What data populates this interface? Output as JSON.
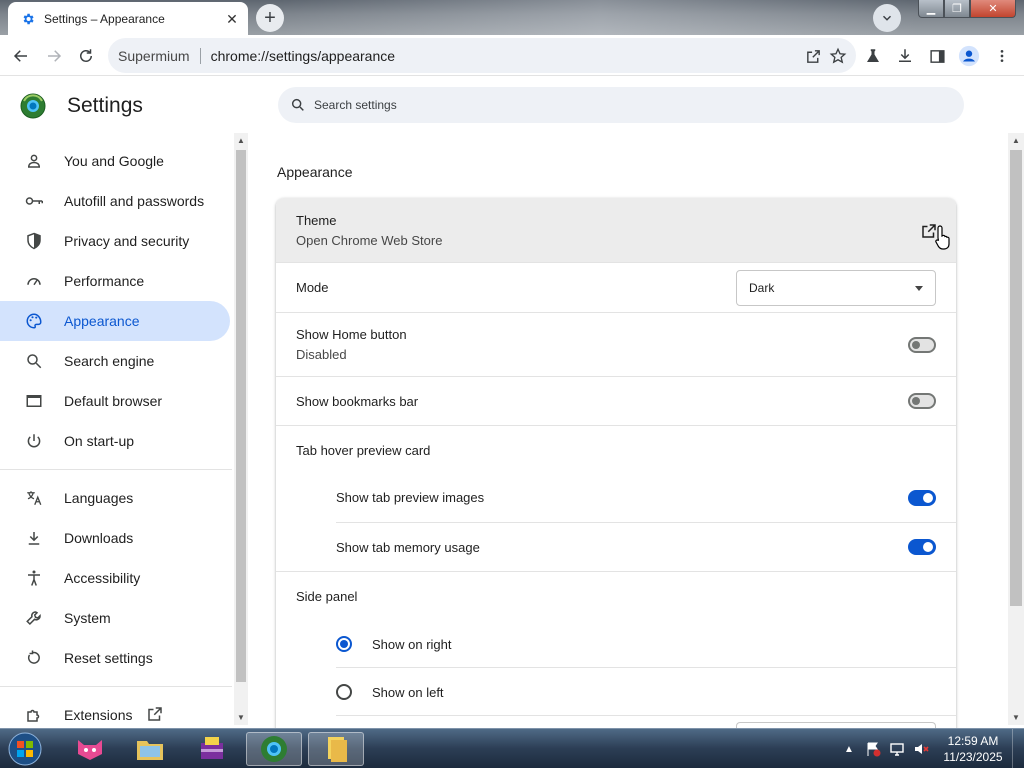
{
  "tab": {
    "title": "Settings – Appearance",
    "close": "✕",
    "new_tab": "+"
  },
  "window": {
    "minimize": "▁",
    "maximize": "❐",
    "close": "✕"
  },
  "omnibox": {
    "chip": "Supermium",
    "url": "chrome://settings/appearance"
  },
  "header": {
    "title": "Settings",
    "search_placeholder": "Search settings"
  },
  "sidebar": {
    "items": [
      {
        "label": "You and Google",
        "icon": "person-icon"
      },
      {
        "label": "Autofill and passwords",
        "icon": "key-icon"
      },
      {
        "label": "Privacy and security",
        "icon": "shield-icon"
      },
      {
        "label": "Performance",
        "icon": "speedometer-icon"
      },
      {
        "label": "Appearance",
        "icon": "palette-icon",
        "active": true
      },
      {
        "label": "Search engine",
        "icon": "search-icon"
      },
      {
        "label": "Default browser",
        "icon": "browser-window-icon"
      },
      {
        "label": "On start-up",
        "icon": "power-icon"
      }
    ],
    "items2": [
      {
        "label": "Languages",
        "icon": "translate-icon"
      },
      {
        "label": "Downloads",
        "icon": "download-icon"
      },
      {
        "label": "Accessibility",
        "icon": "accessibility-icon"
      },
      {
        "label": "System",
        "icon": "wrench-icon"
      },
      {
        "label": "Reset settings",
        "icon": "reset-icon"
      }
    ],
    "extensions": {
      "label": "Extensions",
      "icon": "puzzle-icon"
    }
  },
  "main": {
    "section_title": "Appearance",
    "theme": {
      "label": "Theme",
      "sub": "Open Chrome Web Store"
    },
    "mode": {
      "label": "Mode",
      "value": "Dark"
    },
    "home_button": {
      "label": "Show Home button",
      "sub": "Disabled",
      "enabled": false
    },
    "bookmarks_bar": {
      "label": "Show bookmarks bar",
      "enabled": false
    },
    "tab_hover": {
      "label": "Tab hover preview card",
      "preview_images": {
        "label": "Show tab preview images",
        "enabled": true
      },
      "memory_usage": {
        "label": "Show tab memory usage",
        "enabled": true
      }
    },
    "side_panel": {
      "label": "Side panel",
      "options": [
        {
          "label": "Show on right",
          "selected": true
        },
        {
          "label": "Show on left",
          "selected": false
        }
      ]
    }
  },
  "taskbar": {
    "time": "12:59 AM",
    "date": "11/23/2025"
  },
  "colors": {
    "accent": "#0b57d0",
    "active_nav_bg": "#d3e3fd"
  }
}
